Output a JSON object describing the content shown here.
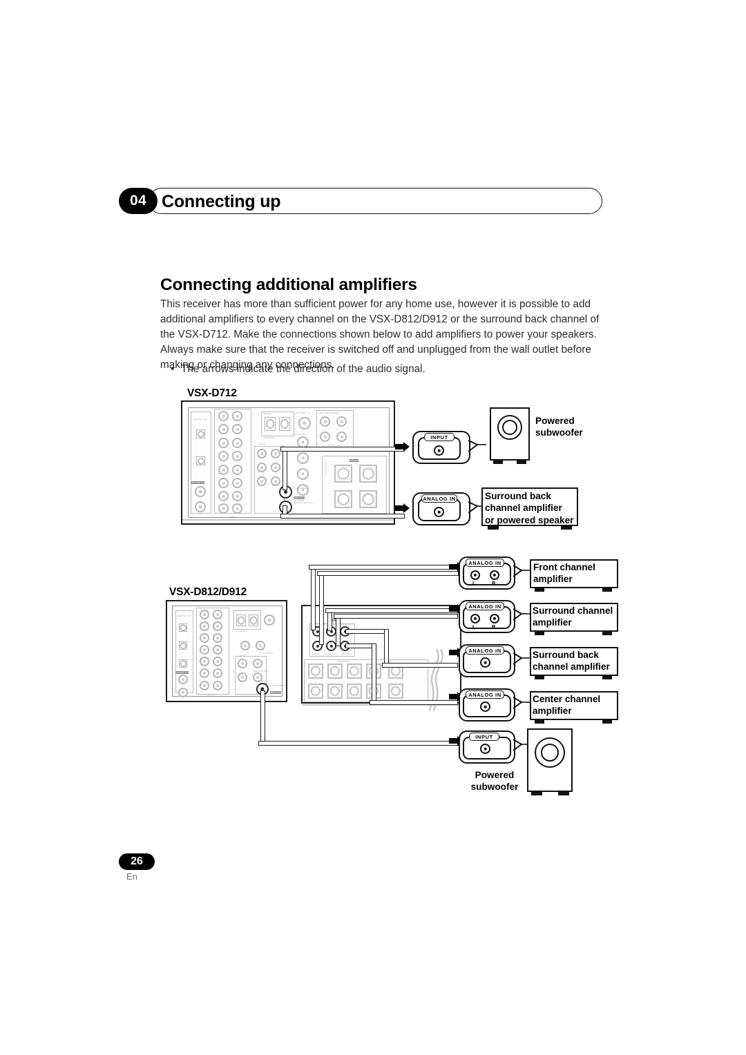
{
  "header": {
    "chapter_number": "04",
    "chapter_title": "Connecting up"
  },
  "section": {
    "title": "Connecting additional amplifiers",
    "paragraph": "This receiver has more than sufficient power for any home use, however it is possible to add additional amplifiers to every channel on the VSX-D812/D912 or the surround back channel of the VSX-D712. Make the connections shown below to add amplifiers to power your speakers. Always make sure that the receiver is switched off and unplugged from the wall outlet before making or changing any connections.",
    "bullet_marker": "•",
    "bullet_text": "The arrows indicate the direction of the audio signal."
  },
  "diagram_712": {
    "model_label": "VSX-D712",
    "panel_jack_labels": {
      "sub_woofer": "SUB WOOFER",
      "preout": "PRE OUT",
      "surround_back": "SURROUND BACK",
      "speakers": "SPEAKERS",
      "antenna": "ANTENNA",
      "digital_out": "DIGITAL OUT",
      "monitor_out": "MONITOR OUT",
      "s_video": "S-VIDEO",
      "video": "VIDEO",
      "audio": "AUDIO",
      "front": "FRONT",
      "surround": "SURROUND",
      "dvd_5_1ch_input": "DVD 5.1CH INPUT"
    },
    "callouts": [
      {
        "jack_label": "INPUT",
        "jack_type": "mono",
        "device_type": "subwoofer",
        "device_label": "Powered\nsubwoofer",
        "device_label_lines": [
          "Powered",
          "subwoofer"
        ]
      },
      {
        "jack_label": "ANALOG IN",
        "jack_type": "mono",
        "device_type": "amplifier",
        "device_label_lines": [
          "Surround back",
          "channel amplifier",
          "or powered speaker"
        ]
      }
    ]
  },
  "diagram_812_912": {
    "model_label": "VSX-D812/D912",
    "panel_jack_labels": {
      "front": "FRONT",
      "surround": "SURROUND",
      "center": "CENTER",
      "surround_back": "SURROUND BACK",
      "preout": "PRE OUT",
      "sub_woofer": "SUB WOOFER",
      "speakers": "SPEAKERS",
      "l": "L",
      "r": "R"
    },
    "callouts": [
      {
        "jack_label": "ANALOG IN",
        "jack_type": "stereo",
        "left_label": "L",
        "right_label": "R",
        "device_type": "amplifier",
        "device_label_lines": [
          "Front channel",
          "amplifier"
        ]
      },
      {
        "jack_label": "ANALOG IN",
        "jack_type": "stereo",
        "left_label": "L",
        "right_label": "R",
        "device_type": "amplifier",
        "device_label_lines": [
          "Surround channel",
          "amplifier"
        ]
      },
      {
        "jack_label": "ANALOG IN",
        "jack_type": "mono",
        "device_type": "amplifier",
        "device_label_lines": [
          "Surround back",
          "channel amplifier"
        ]
      },
      {
        "jack_label": "ANALOG IN",
        "jack_type": "mono",
        "device_type": "amplifier",
        "device_label_lines": [
          "Center channel",
          "amplifier"
        ]
      },
      {
        "jack_label": "INPUT",
        "jack_type": "mono",
        "device_type": "subwoofer",
        "device_label_lines": [
          "Powered",
          "subwoofer"
        ]
      }
    ]
  },
  "footer": {
    "page_number": "26",
    "language_code": "En"
  },
  "colors": {
    "ink": "#111111",
    "body_text": "#2b2b2b",
    "panel_detail": "#b4b4b4",
    "badge_bg": "#000000"
  }
}
